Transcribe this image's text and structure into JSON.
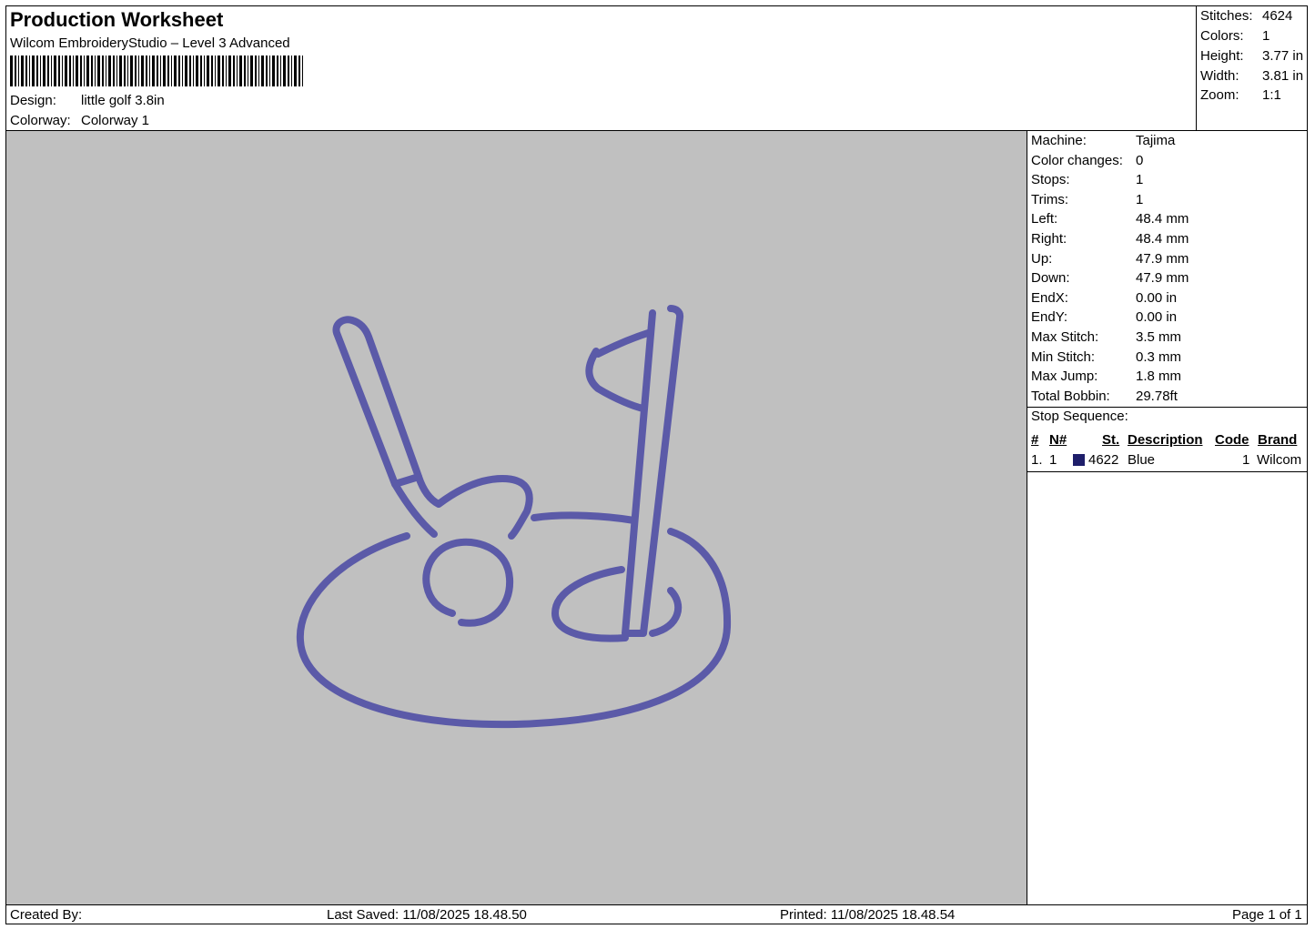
{
  "header": {
    "title": "Production Worksheet",
    "software": "Wilcom EmbroideryStudio – Level 3 Advanced",
    "design_label": "Design:",
    "design_value": "little golf 3.8in",
    "colorway_label": "Colorway:",
    "colorway_value": "Colorway 1"
  },
  "summary": [
    {
      "label": "Stitches:",
      "value": "4624"
    },
    {
      "label": "Colors:",
      "value": "1"
    },
    {
      "label": "Height:",
      "value": "3.77 in"
    },
    {
      "label": "Width:",
      "value": "3.81 in"
    },
    {
      "label": "Zoom:",
      "value": "1:1"
    }
  ],
  "machine": [
    {
      "label": "Machine:",
      "value": "Tajima"
    },
    {
      "label": "Color changes:",
      "value": "0"
    },
    {
      "label": "Stops:",
      "value": "1"
    },
    {
      "label": "Trims:",
      "value": "1"
    },
    {
      "label": "Left:",
      "value": "48.4 mm"
    },
    {
      "label": "Right:",
      "value": "48.4 mm"
    },
    {
      "label": "Up:",
      "value": "47.9 mm"
    },
    {
      "label": "Down:",
      "value": "47.9 mm"
    },
    {
      "label": "EndX:",
      "value": "0.00 in"
    },
    {
      "label": "EndY:",
      "value": "0.00 in"
    },
    {
      "label": "Max Stitch:",
      "value": "3.5 mm"
    },
    {
      "label": "Min Stitch:",
      "value": "0.3 mm"
    },
    {
      "label": "Max Jump:",
      "value": "1.8 mm"
    },
    {
      "label": "Total Bobbin:",
      "value": "29.78ft"
    }
  ],
  "stop_sequence": {
    "title": "Stop Sequence:",
    "columns": [
      "#",
      "N#",
      "St.",
      "Description",
      "Code",
      "Brand"
    ],
    "rows": [
      {
        "index": "1.",
        "n": "1",
        "color": "#1f1f6b",
        "st": "4622",
        "description": "Blue",
        "code": "1",
        "brand": "Wilcom"
      }
    ]
  },
  "thread_color": "#5b5aa8",
  "canvas_color": "#c0c0c0",
  "footer": {
    "created_by": "Created By:",
    "last_saved": "Last Saved: 11/08/2025 18.48.50",
    "printed": "Printed: 11/08/2025 18.48.54",
    "page": "Page 1 of 1"
  }
}
